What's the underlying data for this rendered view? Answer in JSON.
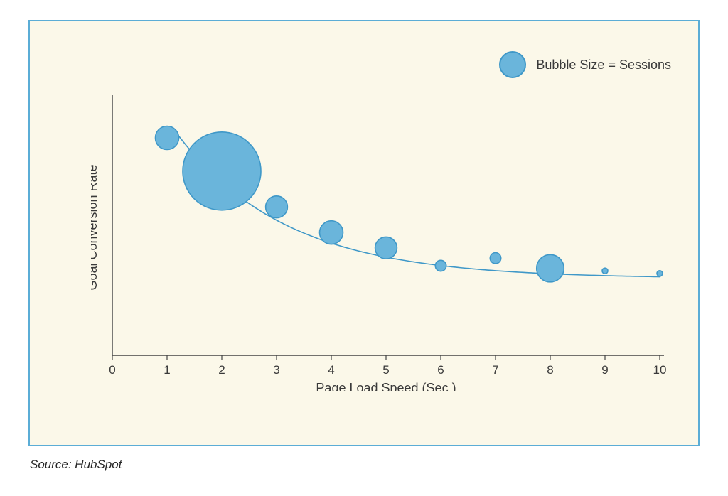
{
  "legend": {
    "label": "Bubble Size = Sessions"
  },
  "axes": {
    "xlabel": "Page Load Speed (Sec.)",
    "ylabel": "Goal Conversion Rate"
  },
  "source": "Source: HubSpot",
  "chart_data": {
    "type": "scatter",
    "title": "",
    "xlabel": "Page Load Speed (Sec.)",
    "ylabel": "Goal Conversion Rate",
    "xlim": [
      0,
      10
    ],
    "x_ticks": [
      0,
      1,
      2,
      3,
      4,
      5,
      6,
      7,
      8,
      9,
      10
    ],
    "legend": "Bubble Size = Sessions",
    "note": "y-axis has no visible tick labels; y_rel and bubble_size_rel are estimated on a 0–1 relative scale read from the plot",
    "points": [
      {
        "x": 1,
        "y_rel": 0.85,
        "bubble_size_rel": 0.3
      },
      {
        "x": 2,
        "y_rel": 0.72,
        "bubble_size_rel": 1.0
      },
      {
        "x": 3,
        "y_rel": 0.58,
        "bubble_size_rel": 0.28
      },
      {
        "x": 4,
        "y_rel": 0.48,
        "bubble_size_rel": 0.3
      },
      {
        "x": 5,
        "y_rel": 0.42,
        "bubble_size_rel": 0.28
      },
      {
        "x": 6,
        "y_rel": 0.35,
        "bubble_size_rel": 0.14
      },
      {
        "x": 7,
        "y_rel": 0.38,
        "bubble_size_rel": 0.14
      },
      {
        "x": 8,
        "y_rel": 0.34,
        "bubble_size_rel": 0.35
      },
      {
        "x": 9,
        "y_rel": 0.33,
        "bubble_size_rel": 0.07
      },
      {
        "x": 10,
        "y_rel": 0.32,
        "bubble_size_rel": 0.05
      }
    ],
    "trendline": "smooth monotonically-decreasing curve through x=1..10"
  },
  "colors": {
    "card_bg": "#fbf8e9",
    "card_border": "#5badd6",
    "bubble_fill": "#6ab5db",
    "bubble_stroke": "#3f98c8",
    "axis": "#444444",
    "text": "#3a3a3a"
  }
}
